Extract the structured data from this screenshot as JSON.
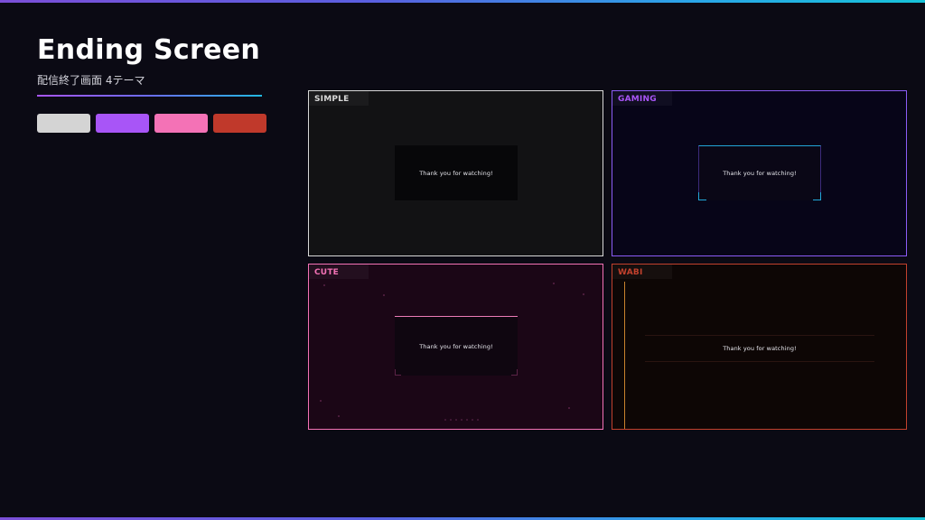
{
  "header": {
    "title": "Ending Screen",
    "subtitle": "配信終了画面 4テーマ"
  },
  "swatches": [
    {
      "name": "simple",
      "color": "#d4d4d4"
    },
    {
      "name": "gaming",
      "color": "#a855f7"
    },
    {
      "name": "cute",
      "color": "#f472b6"
    },
    {
      "name": "wabi",
      "color": "#c0392b"
    }
  ],
  "themes": {
    "simple": {
      "label": "SIMPLE",
      "message": "Thank you for watching!",
      "accent": "#d8d8d8"
    },
    "gaming": {
      "label": "GAMING",
      "message": "Thank you for watching!",
      "accent": "#8b5cf6"
    },
    "cute": {
      "label": "CUTE",
      "message": "Thank you for watching!",
      "accent": "#f472b6"
    },
    "wabi": {
      "label": "WABI",
      "message": "Thank you for watching!",
      "accent": "#c2412d"
    }
  }
}
